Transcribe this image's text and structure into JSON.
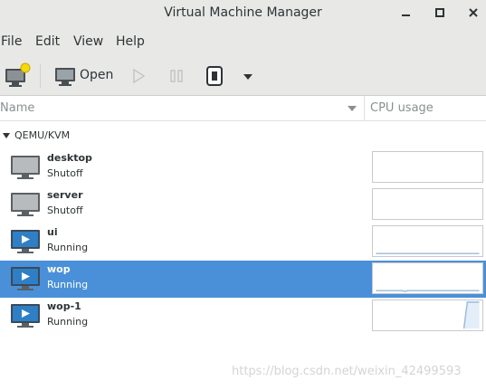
{
  "window": {
    "title": "Virtual Machine Manager"
  },
  "menu": {
    "items": [
      {
        "label": "File"
      },
      {
        "label": "Edit"
      },
      {
        "label": "View"
      },
      {
        "label": "Help"
      }
    ]
  },
  "toolbar": {
    "open_label": "Open"
  },
  "columns": {
    "name": "Name",
    "cpu": "CPU usage"
  },
  "group": {
    "label": "QEMU/KVM"
  },
  "vms": [
    {
      "name": "desktop",
      "status": "Shutoff",
      "selected": false,
      "icon": "monitor-off-icon"
    },
    {
      "name": "server",
      "status": "Shutoff",
      "selected": false,
      "icon": "monitor-off-icon"
    },
    {
      "name": "ui",
      "status": "Running",
      "selected": false,
      "icon": "monitor-play-icon"
    },
    {
      "name": "wop",
      "status": "Running",
      "selected": true,
      "icon": "monitor-play-icon"
    },
    {
      "name": "wop-1",
      "status": "Running",
      "selected": false,
      "icon": "monitor-play-icon"
    }
  ],
  "watermark": "https://blog.csdn.net/weixin_42499593",
  "colors": {
    "selection": "#4a90d9",
    "graph_line": "#9ab9d9"
  }
}
